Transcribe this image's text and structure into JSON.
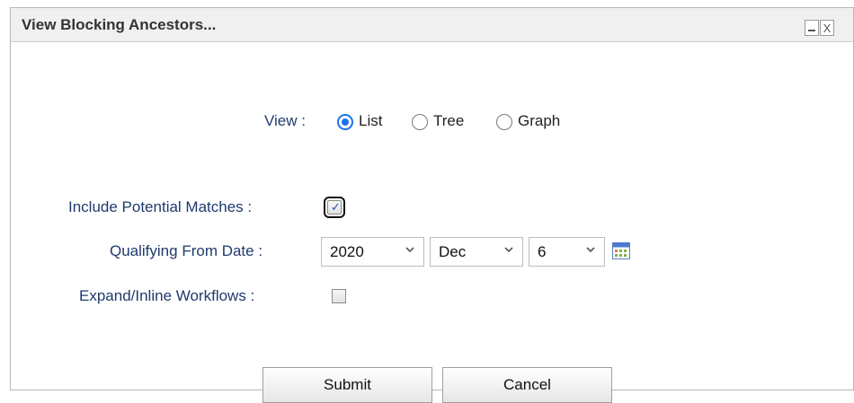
{
  "dialog": {
    "title": "View Blocking Ancestors...",
    "minimize_label": "_",
    "close_label": "X"
  },
  "view": {
    "label": "View :",
    "options": [
      {
        "label": "List",
        "selected": true
      },
      {
        "label": "Tree",
        "selected": false
      },
      {
        "label": "Graph",
        "selected": false
      }
    ]
  },
  "potential_matches": {
    "label": "Include Potential Matches :",
    "checked": true
  },
  "qualifying_date": {
    "label": "Qualifying From Date :",
    "year": "2020",
    "month": "Dec",
    "day": "6"
  },
  "expand_workflows": {
    "label": "Expand/Inline Workflows :",
    "checked": false
  },
  "buttons": {
    "submit": "Submit",
    "cancel": "Cancel"
  },
  "colors": {
    "label_text": "#1f3a6e",
    "accent": "#1a73e8"
  }
}
